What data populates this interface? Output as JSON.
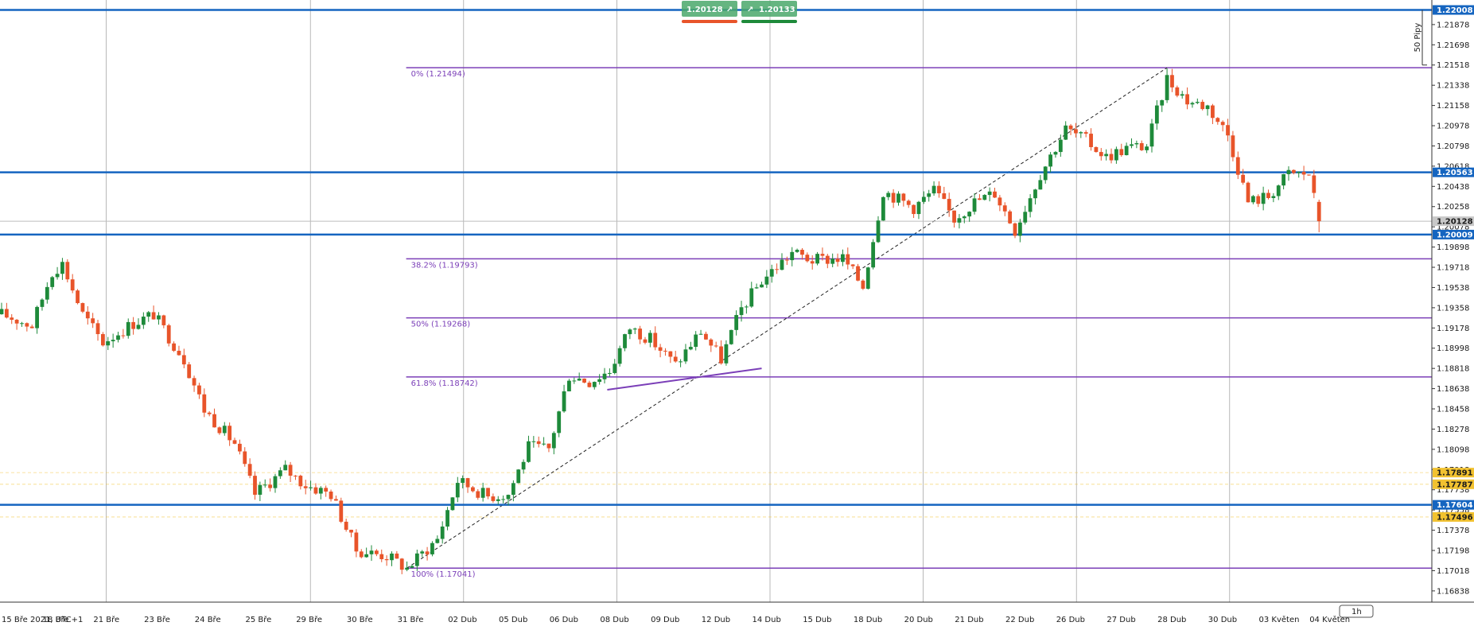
{
  "chart_data": {
    "type": "candlestick",
    "instrument_timezone": "UTC+1",
    "x_ticks": [
      {
        "i": 0,
        "label": "15 Bře 2021, UTC+1"
      },
      {
        "i": 10,
        "label": "18 Bře"
      },
      {
        "i": 20,
        "label": "21 Bře"
      },
      {
        "i": 30,
        "label": "23 Bře"
      },
      {
        "i": 40,
        "label": "24 Bře"
      },
      {
        "i": 50,
        "label": "25 Bře"
      },
      {
        "i": 60,
        "label": "29 Bře"
      },
      {
        "i": 70,
        "label": "30 Bře"
      },
      {
        "i": 80,
        "label": "31 Bře"
      },
      {
        "i": 90,
        "label": "02 Dub"
      },
      {
        "i": 100,
        "label": "05 Dub"
      },
      {
        "i": 110,
        "label": "06 Dub"
      },
      {
        "i": 120,
        "label": "08 Dub"
      },
      {
        "i": 130,
        "label": "09 Dub"
      },
      {
        "i": 140,
        "label": "12 Dub"
      },
      {
        "i": 150,
        "label": "14 Dub"
      },
      {
        "i": 160,
        "label": "15 Dub"
      },
      {
        "i": 170,
        "label": "18 Dub"
      },
      {
        "i": 180,
        "label": "20 Dub"
      },
      {
        "i": 190,
        "label": "21 Dub"
      },
      {
        "i": 200,
        "label": "22 Dub"
      },
      {
        "i": 210,
        "label": "26 Dub"
      },
      {
        "i": 220,
        "label": "27 Dub"
      },
      {
        "i": 230,
        "label": "28 Dub"
      },
      {
        "i": 240,
        "label": "30 Dub"
      },
      {
        "i": 250,
        "label": "03 Květen"
      },
      {
        "i": 260,
        "label": "04 Květen"
      }
    ],
    "y_ticks": [
      "1.21878",
      "1.21698",
      "1.21518",
      "1.21338",
      "1.21158",
      "1.20978",
      "1.20798",
      "1.20618",
      "1.20438",
      "1.20258",
      "1.20078",
      "1.19898",
      "1.19718",
      "1.19538",
      "1.19358",
      "1.19178",
      "1.18998",
      "1.18818",
      "1.18638",
      "1.18458",
      "1.18278",
      "1.18098",
      "1.17918",
      "1.17738",
      "1.17558",
      "1.17378",
      "1.17198",
      "1.17018",
      "1.16838"
    ],
    "y_range": [
      1.16738,
      1.2204
    ],
    "price_levels": [
      {
        "price": 1.22008,
        "label": "1.22008",
        "type": "support-resistance"
      },
      {
        "price": 1.20563,
        "label": "1.20563",
        "type": "support-resistance"
      },
      {
        "price": 1.20009,
        "label": "1.20009",
        "type": "support-resistance"
      },
      {
        "price": 1.17604,
        "label": "1.17604",
        "type": "support-resistance"
      }
    ],
    "alert_levels": [
      {
        "price": 1.17891,
        "label": "1.17891"
      },
      {
        "price": 1.17787,
        "label": "1.17787"
      },
      {
        "price": 1.17496,
        "label": "1.17496"
      }
    ],
    "current_price": {
      "price": 1.20128,
      "label": "1.2012",
      "digit": "8"
    },
    "fibonacci": {
      "levels": [
        {
          "price": 1.21494,
          "label": "0% (1.21494)"
        },
        {
          "price": 1.19793,
          "label": "38.2% (1.19793)"
        },
        {
          "price": 1.19268,
          "label": "50% (1.19268)"
        },
        {
          "price": 1.18742,
          "label": "61.8% (1.18742)"
        },
        {
          "price": 1.17041,
          "label": "100% (1.17041)"
        }
      ],
      "start_index": 80,
      "swing_low": {
        "i": 80,
        "price": 1.17041
      },
      "swing_high": {
        "i": 230,
        "price": 1.21494
      }
    },
    "trendline": {
      "from": {
        "i": 120,
        "price": 1.18628
      },
      "to": {
        "i": 150,
        "price": 1.18818
      }
    },
    "range_label": "50 Pipy",
    "candles": []
  },
  "trade_panel": {
    "sell_price": "1.2012",
    "sell_digit": "8",
    "buy_price": "1.2013",
    "buy_digit": "3",
    "arrow_glyph": "↗"
  },
  "timeframe_label": "1h",
  "colors": {
    "bull": "#1e8a3a",
    "bear": "#e8542a",
    "level_blue": "#1565c0",
    "fib_purple": "#7b3fb8",
    "alert_gold": "#f2c230",
    "grid": "#9a9a9a"
  }
}
